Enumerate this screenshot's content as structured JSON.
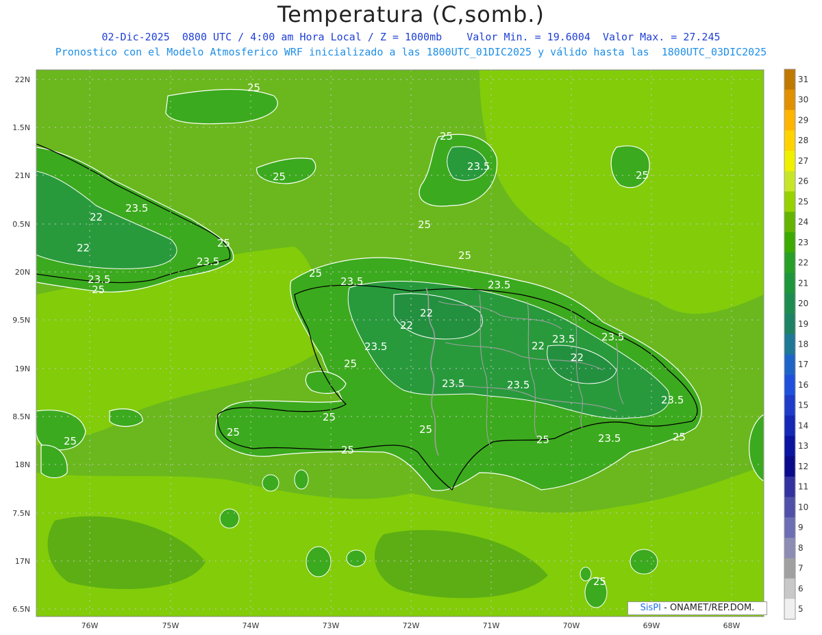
{
  "header": {
    "title": "Temperatura (C,somb.)",
    "line1": "02-Dic-2025  0800 UTC / 4:00 am Hora Local / Z = 1000mb    Valor Min. = 19.6004  Valor Max. = 27.245",
    "line2": "Pronostico con el Modelo Atmosferico WRF inicializado a las 1800UTC_01DIC2025 y válido hasta las  1800UTC_03DIC2025"
  },
  "axes": {
    "lat_labels": [
      "22N",
      "1.5N",
      "21N",
      "0.5N",
      "20N",
      "9.5N",
      "19N",
      "8.5N",
      "18N",
      "7.5N",
      "17N",
      "6.5N"
    ],
    "lon_labels": [
      "76W",
      "75W",
      "74W",
      "73W",
      "72W",
      "71W",
      "70W",
      "69W",
      "68W"
    ]
  },
  "contour_labels": [
    "25",
    "23.5",
    "22"
  ],
  "colorbar": {
    "labels": [
      "31",
      "30",
      "29",
      "28",
      "27",
      "26",
      "25",
      "24",
      "23",
      "22",
      "21",
      "20",
      "19",
      "18",
      "17",
      "16",
      "15",
      "14",
      "13",
      "12",
      "11",
      "10",
      "9",
      "8",
      "7",
      "6",
      "5"
    ],
    "colors": [
      "#c07800",
      "#e09000",
      "#ffb400",
      "#ffd200",
      "#f0f000",
      "#c8e628",
      "#96d200",
      "#64b400",
      "#3caa00",
      "#28a028",
      "#1e963c",
      "#1e8c50",
      "#1e8264",
      "#1e7896",
      "#1e64c8",
      "#1e50dc",
      "#1e3cc8",
      "#1428b4",
      "#0a14a0",
      "#0a0a8c",
      "#3232a0",
      "#5050aa",
      "#6e6eb4",
      "#8c8cb4",
      "#a0a0a0",
      "#c8c8c8",
      "#f0f0f0"
    ]
  },
  "credit": {
    "brand": "SisPI",
    "text": " -  ONAMET/REP.DOM."
  },
  "colors": {
    "sea": "#78c800",
    "land": "#3caa1e",
    "highland": "#289a3c",
    "border": "#a0a0a0",
    "coast": "#000000",
    "contour": "#ffffff"
  }
}
